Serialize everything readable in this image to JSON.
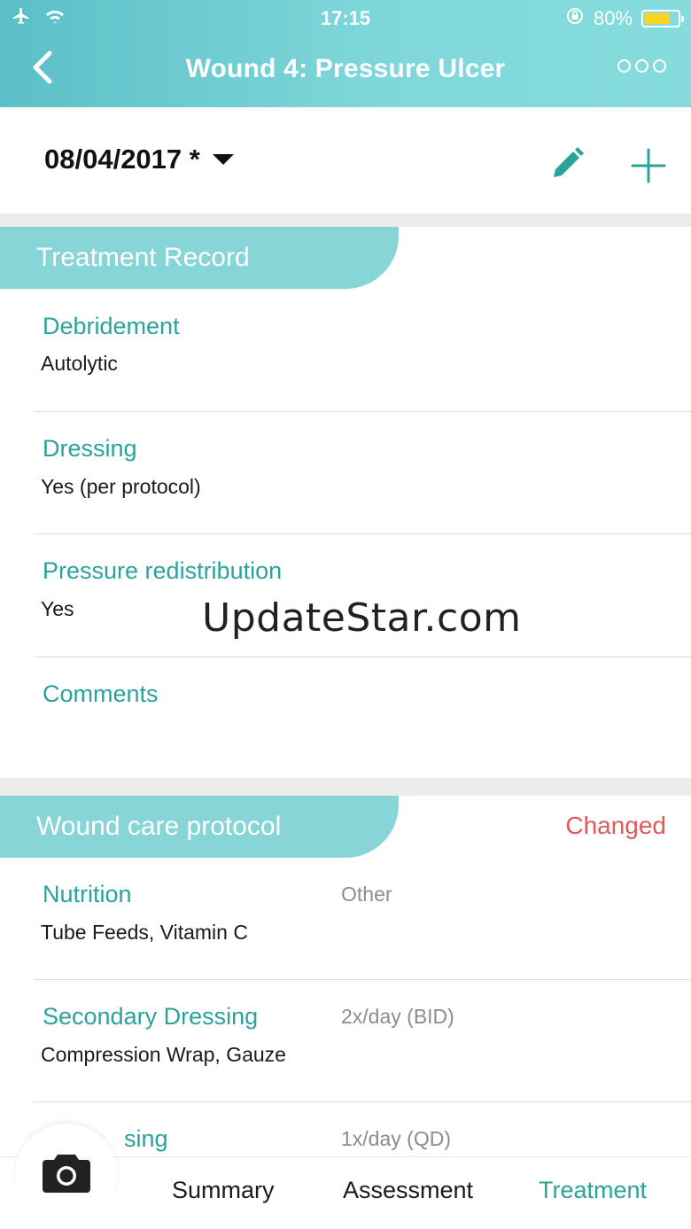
{
  "status_bar": {
    "time": "17:15",
    "battery_pct": "80%",
    "battery_level": 0.8,
    "icons": [
      "airplane-icon",
      "wifi-icon",
      "rotation-lock-icon",
      "battery-icon"
    ]
  },
  "nav": {
    "title": "Wound 4: Pressure Ulcer",
    "back_icon": "chevron-left-icon",
    "more_icon": "more-icon"
  },
  "date_row": {
    "date": "08/04/2017 *",
    "edit_icon": "pencil-icon",
    "add_icon": "plus-icon"
  },
  "treatment_record": {
    "title": "Treatment Record",
    "fields": [
      {
        "label": "Debridement",
        "value": "Autolytic"
      },
      {
        "label": "Dressing",
        "value": "Yes (per protocol)"
      },
      {
        "label": "Pressure redistribution",
        "value": "Yes"
      },
      {
        "label": "Comments",
        "value": ""
      }
    ]
  },
  "watermark": "UpdateStar.com",
  "wound_care_protocol": {
    "title": "Wound care protocol",
    "status": "Changed",
    "fields": [
      {
        "label": "Nutrition",
        "value": "Tube Feeds, Vitamin C",
        "aside": "Other"
      },
      {
        "label": "Secondary Dressing",
        "value": "Compression Wrap, Gauze",
        "aside": "2x/day (BID)"
      },
      {
        "label": "sing",
        "value": "",
        "aside": "1x/day (QD)"
      }
    ]
  },
  "tab_bar": {
    "camera_icon": "camera-icon",
    "tabs": [
      {
        "label": "Summary",
        "active": false
      },
      {
        "label": "Assessment",
        "active": false
      },
      {
        "label": "Treatment",
        "active": true
      }
    ]
  },
  "colors": {
    "accent": "#2aa39c",
    "section_tab": "#87d5d6",
    "header_gradient_start": "#5bbfc7",
    "header_gradient_end": "#86dcdc",
    "changed": "#e05a5a",
    "battery": "#ffd41c"
  }
}
